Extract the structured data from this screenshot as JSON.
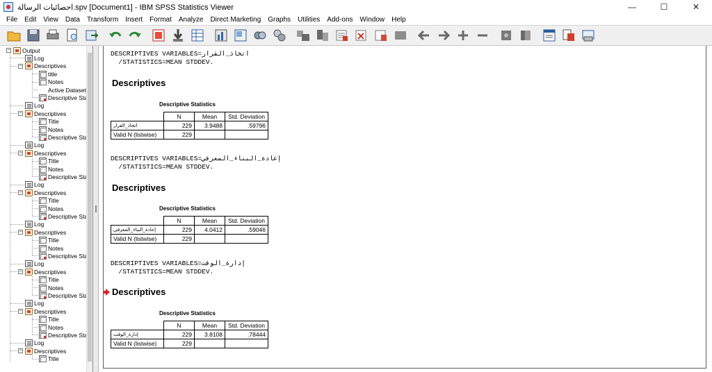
{
  "window": {
    "title": "احصائيات الرسالة.spv [Document1] - IBM SPSS Statistics Viewer",
    "minimize": "—",
    "maximize": "☐",
    "close": "✕"
  },
  "menu": [
    "File",
    "Edit",
    "View",
    "Data",
    "Transform",
    "Insert",
    "Format",
    "Analyze",
    "Direct Marketing",
    "Graphs",
    "Utilities",
    "Add-ons",
    "Window",
    "Help"
  ],
  "toolbar": {
    "icons": [
      "open-icon",
      "save-icon",
      "print-icon",
      "print-preview-icon",
      "export-icon",
      "recall-dialog-icon",
      "undo-icon",
      "redo-icon",
      "goto-data-icon",
      "goto-case-icon",
      "variables-icon",
      "chart-builder-icon",
      "select-cases-icon",
      "show-all-icon",
      "value-labels-icon",
      "expand-icon",
      "collapse-icon",
      "show-icon",
      "hide-icon",
      "designate-window-icon",
      "create-output-icon",
      "insert-text-icon",
      "insert-title-icon",
      "insert-chart-icon",
      "previous-icon",
      "next-icon",
      "promote-icon",
      "demote-icon",
      "show-all-items-icon",
      "hide-items-icon",
      "new-heading-icon",
      "new-title-icon",
      "new-page-icon"
    ]
  },
  "outline": {
    "root": "Output",
    "items": [
      {
        "level": 1,
        "label": "Log",
        "icon": "log"
      },
      {
        "level": 1,
        "label": "Descriptives",
        "icon": "book",
        "expander": "−"
      },
      {
        "level": 2,
        "label": "title",
        "icon": "tbl"
      },
      {
        "level": 2,
        "label": "Notes",
        "icon": "tbl"
      },
      {
        "level": 2,
        "label": "Active Dataset",
        "icon": "none"
      },
      {
        "level": 2,
        "label": "Descriptive Sta",
        "icon": "tbl-red"
      },
      {
        "level": 1,
        "label": "Log",
        "icon": "log"
      },
      {
        "level": 1,
        "label": "Descriptives",
        "icon": "book",
        "expander": "−"
      },
      {
        "level": 2,
        "label": "Title",
        "icon": "tbl"
      },
      {
        "level": 2,
        "label": "Notes",
        "icon": "tbl"
      },
      {
        "level": 2,
        "label": "Descriptive Sta",
        "icon": "tbl-red"
      },
      {
        "level": 1,
        "label": "Log",
        "icon": "log"
      },
      {
        "level": 1,
        "label": "Descriptives",
        "icon": "book",
        "expander": "−"
      },
      {
        "level": 2,
        "label": "Title",
        "icon": "tbl"
      },
      {
        "level": 2,
        "label": "Notes",
        "icon": "tbl"
      },
      {
        "level": 2,
        "label": "Descriptive Sta",
        "icon": "tbl-red"
      },
      {
        "level": 1,
        "label": "Log",
        "icon": "log"
      },
      {
        "level": 1,
        "label": "Descriptives",
        "icon": "book",
        "expander": "−"
      },
      {
        "level": 2,
        "label": "Title",
        "icon": "tbl"
      },
      {
        "level": 2,
        "label": "Notes",
        "icon": "tbl"
      },
      {
        "level": 2,
        "label": "Descriptive Sta",
        "icon": "tbl-red"
      },
      {
        "level": 1,
        "label": "Log",
        "icon": "log"
      },
      {
        "level": 1,
        "label": "Descriptives",
        "icon": "book",
        "expander": "−"
      },
      {
        "level": 2,
        "label": "Title",
        "icon": "tbl"
      },
      {
        "level": 2,
        "label": "Notes",
        "icon": "tbl"
      },
      {
        "level": 2,
        "label": "Descriptive Sta",
        "icon": "tbl-red"
      },
      {
        "level": 1,
        "label": "Log",
        "icon": "log"
      },
      {
        "level": 1,
        "label": "Descriptives",
        "icon": "book",
        "expander": "−"
      },
      {
        "level": 2,
        "label": "Title",
        "icon": "tbl"
      },
      {
        "level": 2,
        "label": "Notes",
        "icon": "tbl"
      },
      {
        "level": 2,
        "label": "Descriptive Sta",
        "icon": "tbl-red"
      },
      {
        "level": 1,
        "label": "Log",
        "icon": "log"
      },
      {
        "level": 1,
        "label": "Descriptives",
        "icon": "book",
        "expander": "−"
      },
      {
        "level": 2,
        "label": "Title",
        "icon": "tbl"
      },
      {
        "level": 2,
        "label": "Notes",
        "icon": "tbl"
      },
      {
        "level": 2,
        "label": "Descriptive Sta",
        "icon": "tbl-red"
      },
      {
        "level": 1,
        "label": "Log",
        "icon": "log"
      },
      {
        "level": 1,
        "label": "Descriptives",
        "icon": "book",
        "expander": "−"
      },
      {
        "level": 2,
        "label": "Title",
        "icon": "tbl"
      }
    ]
  },
  "output": {
    "blocks": [
      {
        "syntax_line1": "DESCRIPTIVES VARIABLES=اتخاذ_القرار",
        "syntax_line2": "  /STATISTICS=MEAN STDDEV.",
        "heading": "Descriptives",
        "table_title": "Descriptive Statistics",
        "columns": [
          "N",
          "Mean",
          "Std. Deviation"
        ],
        "var_label": "اتخاذ_القرار",
        "n": "229",
        "mean": "3.9488",
        "sd": ".59796",
        "listwise_label": "Valid N (listwise)",
        "listwise_n": "229"
      },
      {
        "syntax_line1": "DESCRIPTIVES VARIABLES=إعادة_البناء_المعرفي",
        "syntax_line2": "  /STATISTICS=MEAN STDDEV.",
        "heading": "Descriptives",
        "table_title": "Descriptive Statistics",
        "columns": [
          "N",
          "Mean",
          "Std. Deviation"
        ],
        "var_label": "إعادة_البناء_المعرفي",
        "n": "229",
        "mean": "4.0412",
        "sd": ".59046",
        "listwise_label": "Valid N (listwise)",
        "listwise_n": "229"
      },
      {
        "syntax_line1": "DESCRIPTIVES VARIABLES=إدارة_الوقت",
        "syntax_line2": "  /STATISTICS=MEAN STDDEV.",
        "heading": "Descriptives",
        "table_title": "Descriptive Statistics",
        "columns": [
          "N",
          "Mean",
          "Std. Deviation"
        ],
        "var_label": "إدارة_الوقت",
        "n": "229",
        "mean": "3.8108",
        "sd": ".78444",
        "listwise_label": "Valid N (listwise)",
        "listwise_n": "229"
      }
    ]
  }
}
